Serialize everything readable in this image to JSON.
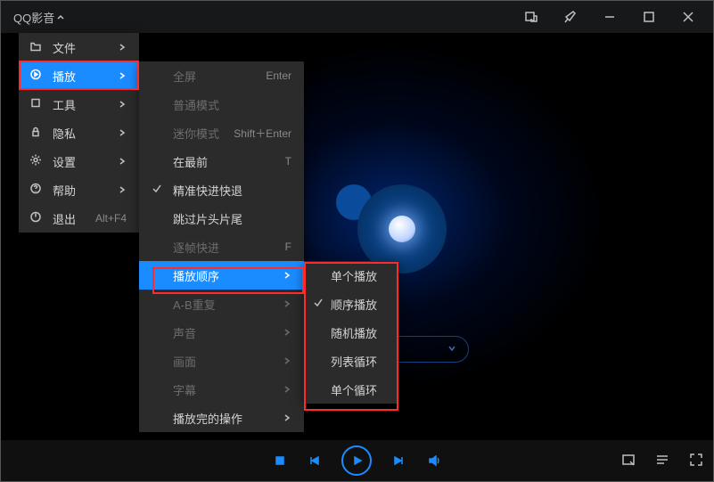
{
  "app": {
    "title": "QQ影音"
  },
  "menu1": {
    "items": [
      {
        "label": "文件",
        "shortcut": ""
      },
      {
        "label": "播放",
        "shortcut": ""
      },
      {
        "label": "工具",
        "shortcut": ""
      },
      {
        "label": "隐私",
        "shortcut": ""
      },
      {
        "label": "设置",
        "shortcut": ""
      },
      {
        "label": "帮助",
        "shortcut": ""
      },
      {
        "label": "退出",
        "shortcut": "Alt+F4"
      }
    ]
  },
  "menu2": {
    "items": [
      {
        "label": "全屏",
        "trail": "Enter"
      },
      {
        "label": "普通模式",
        "trail": ""
      },
      {
        "label": "迷你模式",
        "trail": "Shift＋Enter"
      },
      {
        "label": "在最前",
        "trail": "T"
      },
      {
        "label": "精准快进快退",
        "trail": ""
      },
      {
        "label": "跳过片头片尾",
        "trail": ""
      },
      {
        "label": "逐帧快进",
        "trail": "F"
      },
      {
        "label": "播放顺序",
        "trail": ""
      },
      {
        "label": "A-B重复",
        "trail": ""
      },
      {
        "label": "声音",
        "trail": ""
      },
      {
        "label": "画面",
        "trail": ""
      },
      {
        "label": "字幕",
        "trail": ""
      },
      {
        "label": "播放完的操作",
        "trail": ""
      }
    ]
  },
  "menu3": {
    "items": [
      {
        "label": "单个播放"
      },
      {
        "label": "顺序播放"
      },
      {
        "label": "随机播放"
      },
      {
        "label": "列表循环"
      },
      {
        "label": "单个循环"
      }
    ]
  }
}
